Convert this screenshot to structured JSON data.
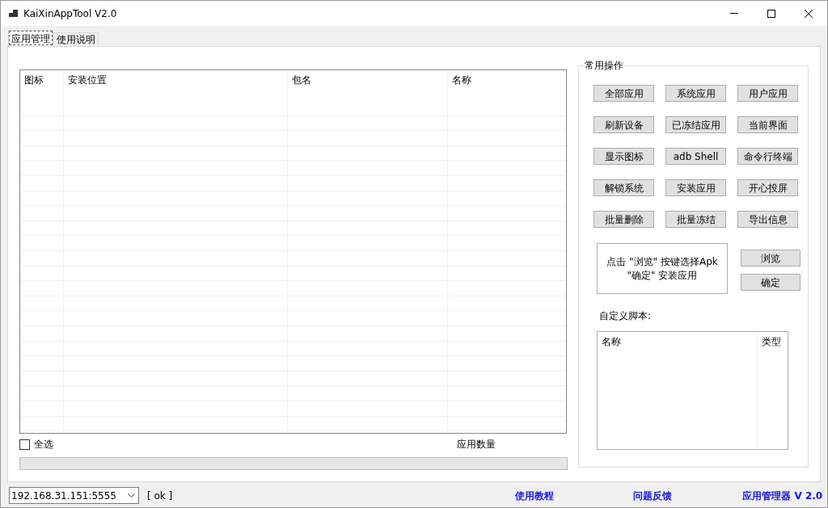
{
  "window": {
    "title": "KaiXinAppTool V2.0"
  },
  "tabs": [
    {
      "label": "应用管理",
      "selected": true
    },
    {
      "label": "使用说明",
      "selected": false
    }
  ],
  "app_list": {
    "columns": [
      "图标",
      "安装位置",
      "包名",
      "名称"
    ]
  },
  "select_all": {
    "label": "全选",
    "checked": false
  },
  "app_count_label": "应用数量",
  "progress": {
    "level": 0
  },
  "operations": {
    "title": "常用操作",
    "buttons": [
      "全部应用",
      "系统应用",
      "用户应用",
      "刷新设备",
      "已冻结应用",
      "当前界面",
      "显示图标",
      "adb Shell",
      "命令行终端",
      "解锁系统",
      "安装应用",
      "开心投屏",
      "批量删除",
      "批量冻结",
      "导出信息"
    ],
    "install_hint": [
      "点击 \"浏览\" 按键选择Apk",
      "\"确定\" 安装应用"
    ],
    "browse_button": "浏览",
    "confirm_button": "确定",
    "script_label": "自定义脚本:",
    "script_list": {
      "columns": [
        "名称",
        "类型"
      ]
    }
  },
  "status_bar": {
    "device": {
      "value": "192.168.31.151:5555"
    },
    "status": "[ ok ]",
    "links": [
      "使用教程",
      "问题反馈",
      "应用管理器 V 2.0"
    ]
  }
}
